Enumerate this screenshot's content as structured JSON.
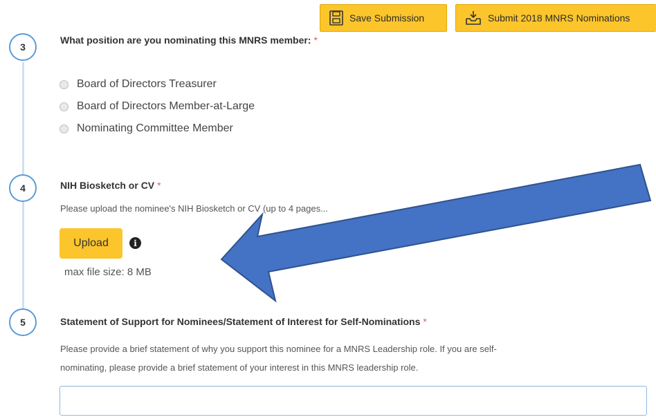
{
  "toolbar": {
    "save_label": "Save Submission",
    "submit_label": "Submit 2018 MNRS Nominations"
  },
  "steps": [
    {
      "number": "3",
      "title": "What position are you nominating this MNRS member:",
      "required_mark": "*",
      "options": [
        "Board of Directors Treasurer",
        "Board of Directors Member-at-Large",
        "Nominating Committee Member"
      ]
    },
    {
      "number": "4",
      "title": "NIH Biosketch or CV",
      "required_mark": "*",
      "help": "Please upload the nominee's NIH Biosketch or CV (up to 4 pages...",
      "upload_label": "Upload",
      "info_glyph": "i",
      "max_size": "max file size: 8 MB"
    },
    {
      "number": "5",
      "title": "Statement of Support for Nominees/Statement of Interest for Self-Nominations",
      "required_mark": "*",
      "help_line1": "Please provide a brief statement of why you support this nominee for a MNRS Leadership role. If you are self-",
      "help_line2": "nominating, please provide a brief statement of your interest in this MNRS leadership role.",
      "input_value": ""
    }
  ],
  "colors": {
    "accent_yellow": "#fcc52c",
    "step_blue": "#5b9bd5",
    "arrow_blue": "#4472c4",
    "required_red": "#e05a5a"
  },
  "icons": {
    "save": "save-disk-icon",
    "submit": "inbox-download-icon",
    "info": "info-icon",
    "annotation": "blue-arrow-annotation"
  }
}
